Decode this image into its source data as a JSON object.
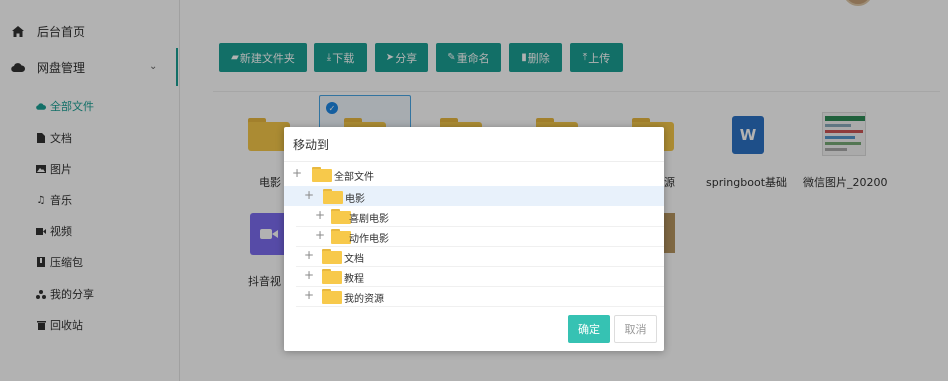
{
  "sidebar": {
    "home": {
      "label": "后台首页",
      "icon": "home-icon"
    },
    "disk": {
      "label": "网盘管理",
      "icon": "cloud-icon"
    },
    "sub_items": [
      {
        "label": "全部文件",
        "icon": "cloud-icon",
        "active": true
      },
      {
        "label": "文档",
        "icon": "document-icon"
      },
      {
        "label": "图片",
        "icon": "image-icon"
      },
      {
        "label": "音乐",
        "icon": "music-icon"
      },
      {
        "label": "视频",
        "icon": "video-icon"
      },
      {
        "label": "压缩包",
        "icon": "archive-icon"
      },
      {
        "label": "我的分享",
        "icon": "share-icon"
      },
      {
        "label": "回收站",
        "icon": "trash-icon"
      }
    ]
  },
  "toolbar": {
    "new_folder": "新建文件夹",
    "download": "下载",
    "share": "分享",
    "rename": "重命名",
    "delete": "删除",
    "upload": "上传"
  },
  "files": [
    {
      "name": "电影"
    },
    {
      "name": "源"
    },
    {
      "name": "springboot基础"
    },
    {
      "name": "微信图片_20200"
    },
    {
      "name": "抖音视"
    }
  ],
  "colors": {
    "accent": "#1aa094",
    "folder": "#f5c74a",
    "selected_row": "#e8f1fb"
  },
  "modal": {
    "title": "移动到",
    "tree": [
      {
        "label": "全部文件"
      },
      {
        "label": "电影",
        "selected": true
      },
      {
        "label": "喜剧电影"
      },
      {
        "label": "动作电影"
      },
      {
        "label": "文档"
      },
      {
        "label": "教程"
      },
      {
        "label": "我的资源"
      }
    ],
    "confirm": "确定",
    "cancel": "取消"
  }
}
